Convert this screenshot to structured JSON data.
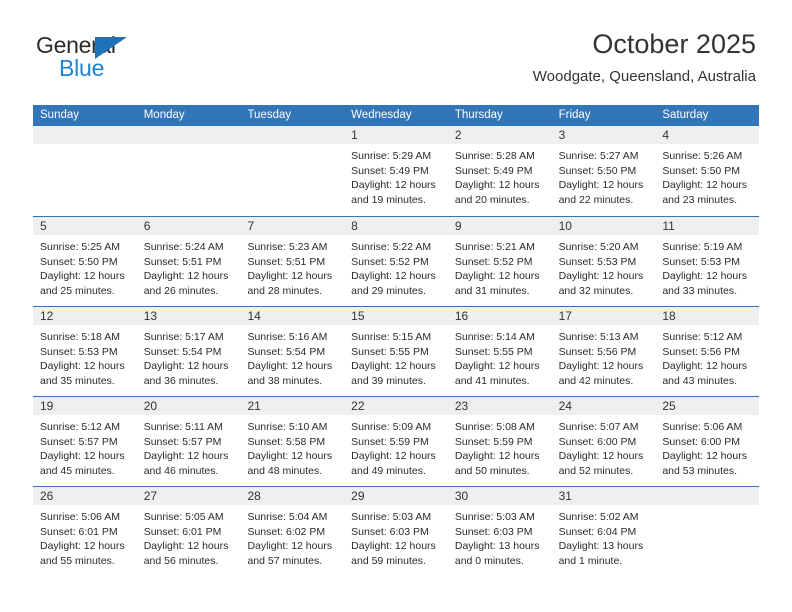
{
  "brand": {
    "name_part1": "General",
    "name_part2": "Blue",
    "triangle_icon": "triangle-icon",
    "color_dark": "#2b2b2b",
    "color_blue": "#1f83d6"
  },
  "header": {
    "title": "October 2025",
    "subtitle": "Woodgate, Queensland, Australia"
  },
  "theme": {
    "header_blue": "#3275b8",
    "day_band_gray": "#efefef",
    "text": "#2b2b2b"
  },
  "weekdays": [
    "Sunday",
    "Monday",
    "Tuesday",
    "Wednesday",
    "Thursday",
    "Friday",
    "Saturday"
  ],
  "weeks": [
    [
      {
        "day": "",
        "lines": []
      },
      {
        "day": "",
        "lines": []
      },
      {
        "day": "",
        "lines": []
      },
      {
        "day": "1",
        "lines": [
          "Sunrise: 5:29 AM",
          "Sunset: 5:49 PM",
          "Daylight: 12 hours",
          "and 19 minutes."
        ]
      },
      {
        "day": "2",
        "lines": [
          "Sunrise: 5:28 AM",
          "Sunset: 5:49 PM",
          "Daylight: 12 hours",
          "and 20 minutes."
        ]
      },
      {
        "day": "3",
        "lines": [
          "Sunrise: 5:27 AM",
          "Sunset: 5:50 PM",
          "Daylight: 12 hours",
          "and 22 minutes."
        ]
      },
      {
        "day": "4",
        "lines": [
          "Sunrise: 5:26 AM",
          "Sunset: 5:50 PM",
          "Daylight: 12 hours",
          "and 23 minutes."
        ]
      }
    ],
    [
      {
        "day": "5",
        "lines": [
          "Sunrise: 5:25 AM",
          "Sunset: 5:50 PM",
          "Daylight: 12 hours",
          "and 25 minutes."
        ]
      },
      {
        "day": "6",
        "lines": [
          "Sunrise: 5:24 AM",
          "Sunset: 5:51 PM",
          "Daylight: 12 hours",
          "and 26 minutes."
        ]
      },
      {
        "day": "7",
        "lines": [
          "Sunrise: 5:23 AM",
          "Sunset: 5:51 PM",
          "Daylight: 12 hours",
          "and 28 minutes."
        ]
      },
      {
        "day": "8",
        "lines": [
          "Sunrise: 5:22 AM",
          "Sunset: 5:52 PM",
          "Daylight: 12 hours",
          "and 29 minutes."
        ]
      },
      {
        "day": "9",
        "lines": [
          "Sunrise: 5:21 AM",
          "Sunset: 5:52 PM",
          "Daylight: 12 hours",
          "and 31 minutes."
        ]
      },
      {
        "day": "10",
        "lines": [
          "Sunrise: 5:20 AM",
          "Sunset: 5:53 PM",
          "Daylight: 12 hours",
          "and 32 minutes."
        ]
      },
      {
        "day": "11",
        "lines": [
          "Sunrise: 5:19 AM",
          "Sunset: 5:53 PM",
          "Daylight: 12 hours",
          "and 33 minutes."
        ]
      }
    ],
    [
      {
        "day": "12",
        "lines": [
          "Sunrise: 5:18 AM",
          "Sunset: 5:53 PM",
          "Daylight: 12 hours",
          "and 35 minutes."
        ]
      },
      {
        "day": "13",
        "lines": [
          "Sunrise: 5:17 AM",
          "Sunset: 5:54 PM",
          "Daylight: 12 hours",
          "and 36 minutes."
        ]
      },
      {
        "day": "14",
        "lines": [
          "Sunrise: 5:16 AM",
          "Sunset: 5:54 PM",
          "Daylight: 12 hours",
          "and 38 minutes."
        ]
      },
      {
        "day": "15",
        "lines": [
          "Sunrise: 5:15 AM",
          "Sunset: 5:55 PM",
          "Daylight: 12 hours",
          "and 39 minutes."
        ]
      },
      {
        "day": "16",
        "lines": [
          "Sunrise: 5:14 AM",
          "Sunset: 5:55 PM",
          "Daylight: 12 hours",
          "and 41 minutes."
        ]
      },
      {
        "day": "17",
        "lines": [
          "Sunrise: 5:13 AM",
          "Sunset: 5:56 PM",
          "Daylight: 12 hours",
          "and 42 minutes."
        ]
      },
      {
        "day": "18",
        "lines": [
          "Sunrise: 5:12 AM",
          "Sunset: 5:56 PM",
          "Daylight: 12 hours",
          "and 43 minutes."
        ]
      }
    ],
    [
      {
        "day": "19",
        "lines": [
          "Sunrise: 5:12 AM",
          "Sunset: 5:57 PM",
          "Daylight: 12 hours",
          "and 45 minutes."
        ]
      },
      {
        "day": "20",
        "lines": [
          "Sunrise: 5:11 AM",
          "Sunset: 5:57 PM",
          "Daylight: 12 hours",
          "and 46 minutes."
        ]
      },
      {
        "day": "21",
        "lines": [
          "Sunrise: 5:10 AM",
          "Sunset: 5:58 PM",
          "Daylight: 12 hours",
          "and 48 minutes."
        ]
      },
      {
        "day": "22",
        "lines": [
          "Sunrise: 5:09 AM",
          "Sunset: 5:59 PM",
          "Daylight: 12 hours",
          "and 49 minutes."
        ]
      },
      {
        "day": "23",
        "lines": [
          "Sunrise: 5:08 AM",
          "Sunset: 5:59 PM",
          "Daylight: 12 hours",
          "and 50 minutes."
        ]
      },
      {
        "day": "24",
        "lines": [
          "Sunrise: 5:07 AM",
          "Sunset: 6:00 PM",
          "Daylight: 12 hours",
          "and 52 minutes."
        ]
      },
      {
        "day": "25",
        "lines": [
          "Sunrise: 5:06 AM",
          "Sunset: 6:00 PM",
          "Daylight: 12 hours",
          "and 53 minutes."
        ]
      }
    ],
    [
      {
        "day": "26",
        "lines": [
          "Sunrise: 5:06 AM",
          "Sunset: 6:01 PM",
          "Daylight: 12 hours",
          "and 55 minutes."
        ]
      },
      {
        "day": "27",
        "lines": [
          "Sunrise: 5:05 AM",
          "Sunset: 6:01 PM",
          "Daylight: 12 hours",
          "and 56 minutes."
        ]
      },
      {
        "day": "28",
        "lines": [
          "Sunrise: 5:04 AM",
          "Sunset: 6:02 PM",
          "Daylight: 12 hours",
          "and 57 minutes."
        ]
      },
      {
        "day": "29",
        "lines": [
          "Sunrise: 5:03 AM",
          "Sunset: 6:03 PM",
          "Daylight: 12 hours",
          "and 59 minutes."
        ]
      },
      {
        "day": "30",
        "lines": [
          "Sunrise: 5:03 AM",
          "Sunset: 6:03 PM",
          "Daylight: 13 hours",
          "and 0 minutes."
        ]
      },
      {
        "day": "31",
        "lines": [
          "Sunrise: 5:02 AM",
          "Sunset: 6:04 PM",
          "Daylight: 13 hours",
          "and 1 minute."
        ]
      },
      {
        "day": "",
        "lines": []
      }
    ]
  ]
}
